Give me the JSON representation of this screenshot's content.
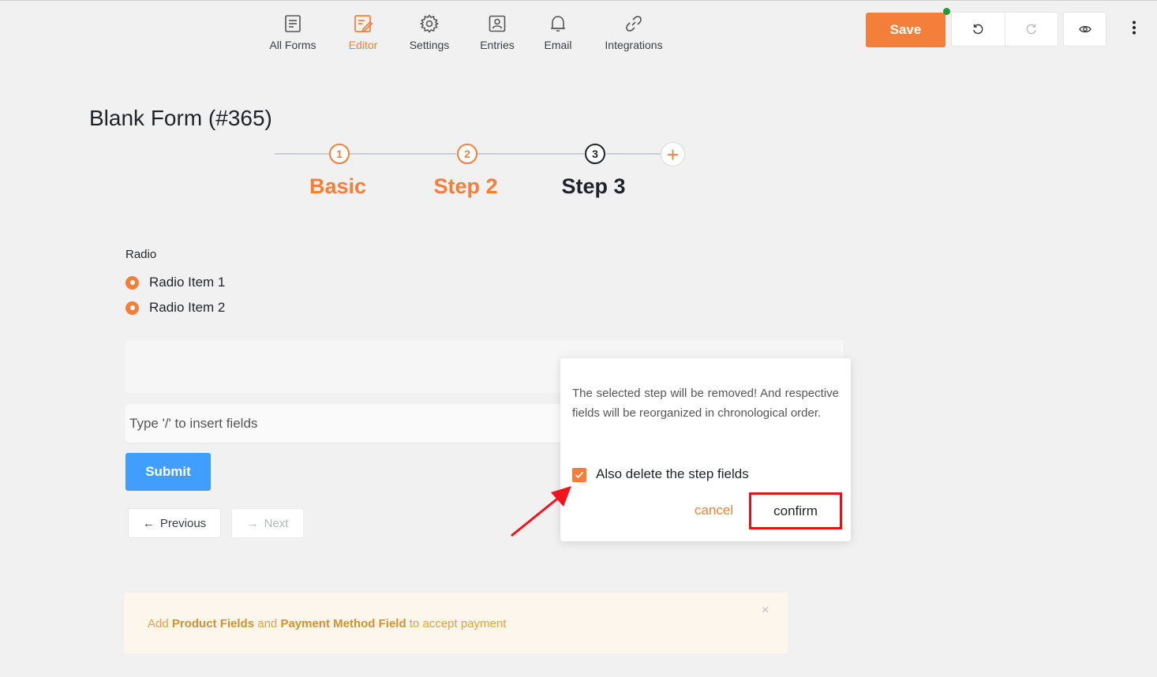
{
  "nav": {
    "items": [
      {
        "label": "All Forms",
        "icon": "form-list-icon"
      },
      {
        "label": "Editor",
        "icon": "editor-icon",
        "active": true
      },
      {
        "label": "Settings",
        "icon": "gear-icon"
      },
      {
        "label": "Entries",
        "icon": "entries-icon"
      },
      {
        "label": "Email",
        "icon": "bell-icon"
      },
      {
        "label": "Integrations",
        "icon": "link-icon"
      }
    ],
    "save_label": "Save"
  },
  "colors": {
    "accent": "#f47f3a",
    "primary": "#409eff",
    "highlight": "#e3121b",
    "online": "#1a9d2e"
  },
  "form": {
    "title": "Blank Form (#365)",
    "steps": [
      {
        "number": "1",
        "label": "Basic"
      },
      {
        "number": "2",
        "label": "Step 2"
      },
      {
        "number": "3",
        "label": "Step 3"
      }
    ],
    "add_step": "+",
    "radio": {
      "label": "Radio",
      "items": [
        "Radio Item 1",
        "Radio Item 2"
      ]
    },
    "insert_placeholder": "Type '/' to insert fields",
    "submit_label": "Submit",
    "previous_label": "Previous",
    "next_label": "Next"
  },
  "popover": {
    "message": "The selected step will be removed! And respective fields will be reorganized in chronological order.",
    "checkbox_label": "Also delete the step fields",
    "checkbox_checked": true,
    "cancel_label": "cancel",
    "confirm_label": "confirm"
  },
  "notice": {
    "prefix": "Add",
    "product": "Product Fields",
    "and": "and",
    "payment": "Payment Method Field",
    "suffix": "to accept payment",
    "close": "×"
  }
}
